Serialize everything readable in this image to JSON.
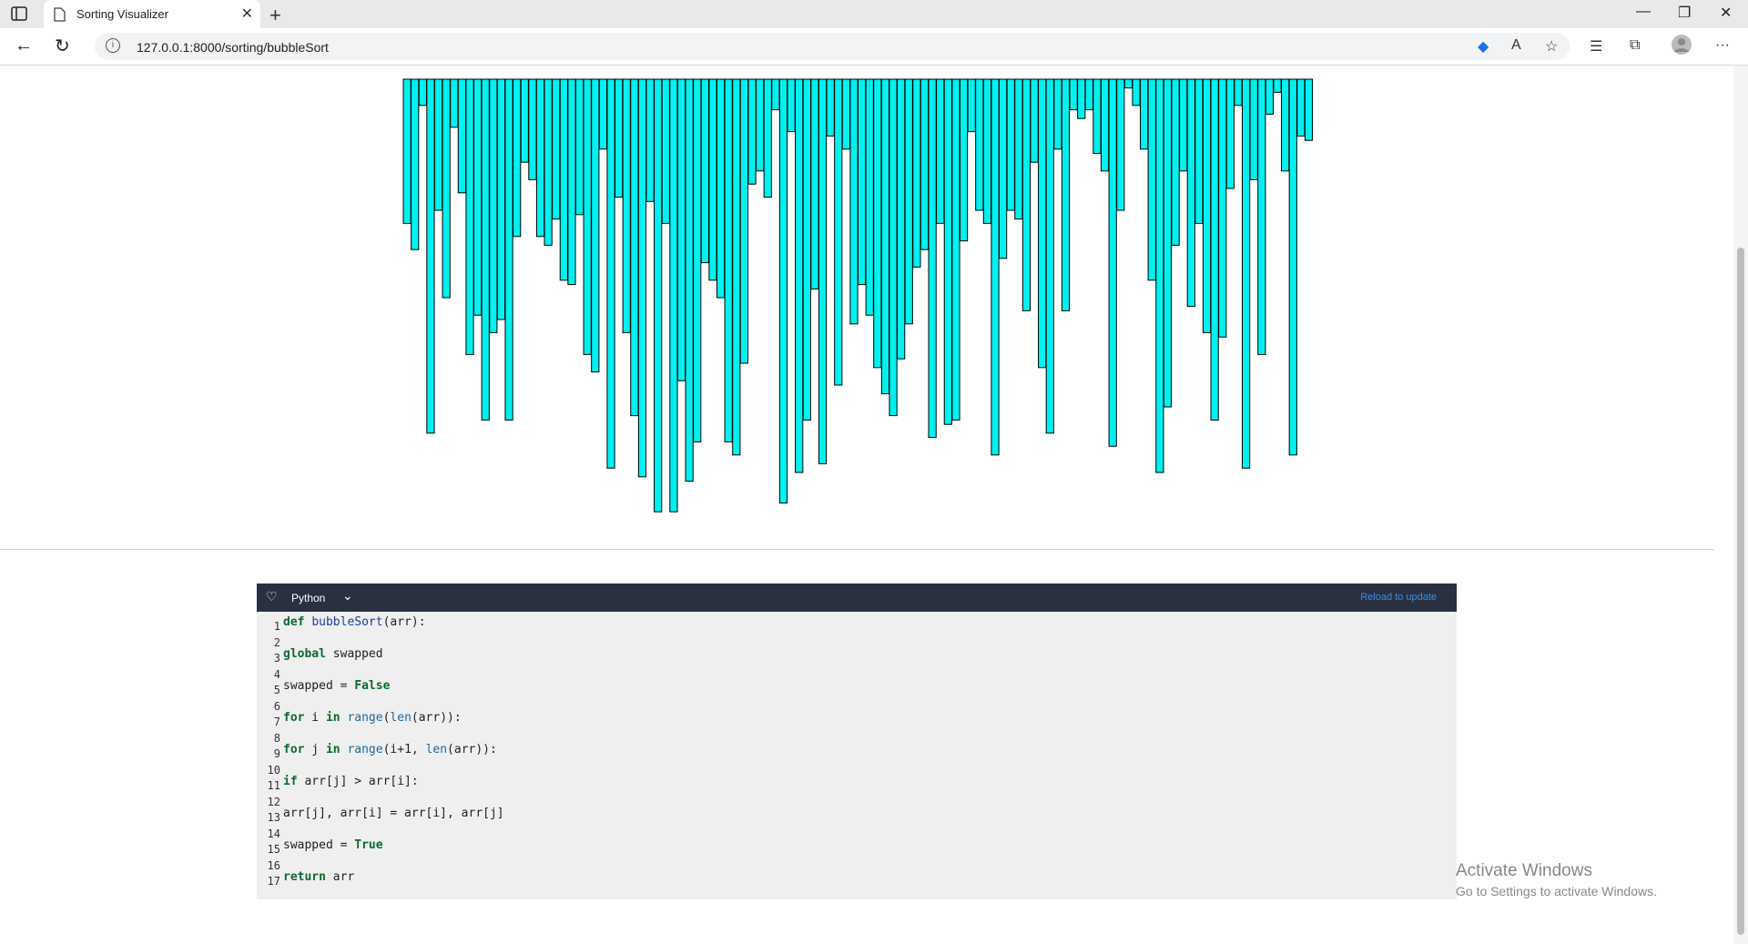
{
  "browser": {
    "tab_title": "Sorting Visualizer",
    "url": "127.0.0.1:8000/sorting/bubbleSort",
    "icons": [
      "sidebar-icon",
      "page-icon",
      "close-icon",
      "plus-icon",
      "minimize-icon",
      "restore-icon",
      "close-window-icon",
      "back-icon",
      "reload-icon",
      "info-icon",
      "tag-icon",
      "read-aloud-icon",
      "favorite-icon",
      "favorites-icon",
      "collections-icon",
      "profile-icon",
      "more-icon"
    ]
  },
  "visualizer": {
    "bar_color": "#00f0f0",
    "bar_border": "#000000",
    "bar_values": [
      0.33,
      0.39,
      0.06,
      0.81,
      0.3,
      0.5,
      0.11,
      0.26,
      0.63,
      0.54,
      0.78,
      0.58,
      0.55,
      0.78,
      0.36,
      0.19,
      0.23,
      0.36,
      0.38,
      0.32,
      0.46,
      0.47,
      0.31,
      0.63,
      0.67,
      0.16,
      0.89,
      0.27,
      0.58,
      0.77,
      0.91,
      0.28,
      0.99,
      0.33,
      0.99,
      0.69,
      0.92,
      0.83,
      0.42,
      0.46,
      0.5,
      0.83,
      0.86,
      0.65,
      0.24,
      0.21,
      0.27,
      0.07,
      0.97,
      0.12,
      0.9,
      0.78,
      0.48,
      0.88,
      0.13,
      0.7,
      0.16,
      0.56,
      0.47,
      0.54,
      0.66,
      0.72,
      0.77,
      0.64,
      0.56,
      0.43,
      0.39,
      0.82,
      0.33,
      0.79,
      0.78,
      0.37,
      0.12,
      0.3,
      0.33,
      0.86,
      0.41,
      0.3,
      0.32,
      0.53,
      0.19,
      0.66,
      0.81,
      0.16,
      0.53,
      0.07,
      0.09,
      0.07,
      0.17,
      0.21,
      0.84,
      0.3,
      0.02,
      0.06,
      0.16,
      0.46,
      0.9,
      0.75,
      0.38,
      0.21,
      0.52,
      0.33,
      0.58,
      0.78,
      0.59,
      0.25,
      0.06,
      0.89,
      0.23,
      0.63,
      0.08,
      0.03,
      0.21,
      0.86,
      0.13,
      0.14
    ],
    "scale_max": 1.0
  },
  "editor": {
    "language": "Python",
    "reload_label": "Reload to update",
    "lines": [
      "def bubbleSort(arr):",
      "",
      "global swapped",
      "",
      "swapped = False",
      "",
      "for i in range(len(arr)):",
      "",
      "for j in range(i+1, len(arr)):",
      "",
      "if arr[j] > arr[i]:",
      "",
      "arr[j], arr[i] = arr[i], arr[j]",
      "",
      "swapped = True",
      "",
      "return arr"
    ],
    "line_numbers": [
      "1",
      "2",
      "3",
      "4",
      "5",
      "6",
      "7",
      "8",
      "9",
      "10",
      "11",
      "12",
      "13",
      "14",
      "15",
      "16",
      "17"
    ]
  },
  "watermark": {
    "title": "Activate Windows",
    "subtitle": "Go to Settings to activate Windows."
  }
}
